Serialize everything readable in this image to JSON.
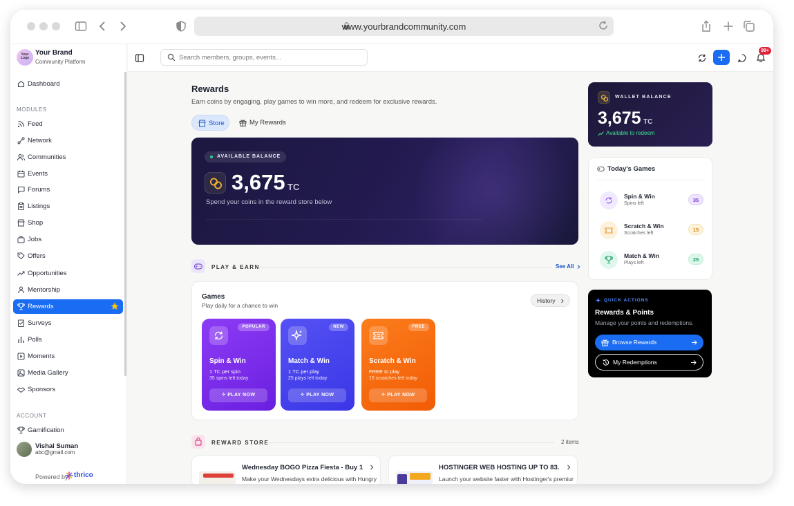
{
  "browser": {
    "url": "www.yourbrandcommunity.com"
  },
  "brand": {
    "logo_text": "Your Logo",
    "name": "Your Brand",
    "subtitle": "Community Platform"
  },
  "sidebar": {
    "dashboard": "Dashboard",
    "modules_heading": "MODULES",
    "items": [
      {
        "label": "Feed",
        "icon": "rss-icon"
      },
      {
        "label": "Network",
        "icon": "network-icon"
      },
      {
        "label": "Communities",
        "icon": "users-icon"
      },
      {
        "label": "Events",
        "icon": "calendar-icon"
      },
      {
        "label": "Forums",
        "icon": "chat-icon"
      },
      {
        "label": "Listings",
        "icon": "clipboard-icon"
      },
      {
        "label": "Shop",
        "icon": "store-icon"
      },
      {
        "label": "Jobs",
        "icon": "briefcase-icon"
      },
      {
        "label": "Offers",
        "icon": "tag-icon"
      },
      {
        "label": "Opportunities",
        "icon": "trending-icon"
      },
      {
        "label": "Mentorship",
        "icon": "mentor-icon"
      },
      {
        "label": "Rewards",
        "icon": "trophy-icon",
        "active": true
      },
      {
        "label": "Surveys",
        "icon": "survey-icon"
      },
      {
        "label": "Polls",
        "icon": "bar-chart-icon"
      },
      {
        "label": "Moments",
        "icon": "play-square-icon"
      },
      {
        "label": "Media Gallery",
        "icon": "image-icon"
      },
      {
        "label": "Sponsors",
        "icon": "handshake-icon"
      }
    ],
    "account_heading": "ACCOUNT",
    "gamification": "Gamification",
    "user": {
      "name": "Vishal Suman",
      "email": "abc@gmail.com"
    },
    "powered_by": "Powered by",
    "powered_brand": "thrico"
  },
  "topbar": {
    "search_placeholder": "Search members, groups, events...",
    "notification_count": "99+"
  },
  "page": {
    "title": "Rewards",
    "subtitle": "Earn coins by engaging, play games to win more, and redeem for exclusive rewards.",
    "tabs": [
      {
        "label": "Store",
        "active": true
      },
      {
        "label": "My Rewards",
        "active": false
      }
    ]
  },
  "hero": {
    "pill": "AVAILABLE BALANCE",
    "amount": "3,675",
    "unit": "TC",
    "subtitle": "Spend your coins in the reward store below"
  },
  "play_earn": {
    "heading": "PLAY & EARN",
    "see_all": "See All"
  },
  "games": {
    "title": "Games",
    "subtitle": "Play daily for a chance to win",
    "history": "History",
    "cards": [
      {
        "badge": "POPULAR",
        "name": "Spin & Win",
        "line1": "1 TC per spin",
        "line2": "35 spins left today",
        "button": "PLAY NOW",
        "color": "#7b2ff0"
      },
      {
        "badge": "NEW",
        "name": "Match & Win",
        "line1": "1 TC per play",
        "line2": "25 plays left today",
        "button": "PLAY NOW",
        "color": "#4a45f0"
      },
      {
        "badge": "FREE",
        "name": "Scratch & Win",
        "line1": "FREE to play",
        "line2": "15 scratches left today",
        "button": "PLAY NOW",
        "color": "#f86b10"
      }
    ]
  },
  "reward_store": {
    "heading": "REWARD STORE",
    "count": "2 items",
    "items": [
      {
        "title": "Wednesday BOGO Pizza Fiesta - Buy 1...",
        "subtitle": "Make your Wednesdays extra delicious with Hungry"
      },
      {
        "title": "HOSTINGER WEB HOSTING UP TO 83...",
        "subtitle": "Launch your website faster with Hostinger's premium"
      }
    ]
  },
  "wallet": {
    "label": "WALLET BALANCE",
    "amount": "3,675",
    "unit": "TC",
    "status": "Available to redeem"
  },
  "todays_games": {
    "title": "Today's Games",
    "items": [
      {
        "name": "Spin & Win",
        "sub": "Spins left",
        "count": "35"
      },
      {
        "name": "Scratch & Win",
        "sub": "Scratches left",
        "count": "15"
      },
      {
        "name": "Match & Win",
        "sub": "Plays left",
        "count": "25"
      }
    ]
  },
  "quick_actions": {
    "label": "QUICK ACTIONS",
    "title": "Rewards & Points",
    "subtitle": "Manage your points and redemptions.",
    "primary": "Browse Rewards",
    "secondary": "My Redemptions"
  },
  "colors": {
    "accent": "#1a6cf2",
    "hero_bg": "#1b1840",
    "success": "#2bd58f"
  }
}
